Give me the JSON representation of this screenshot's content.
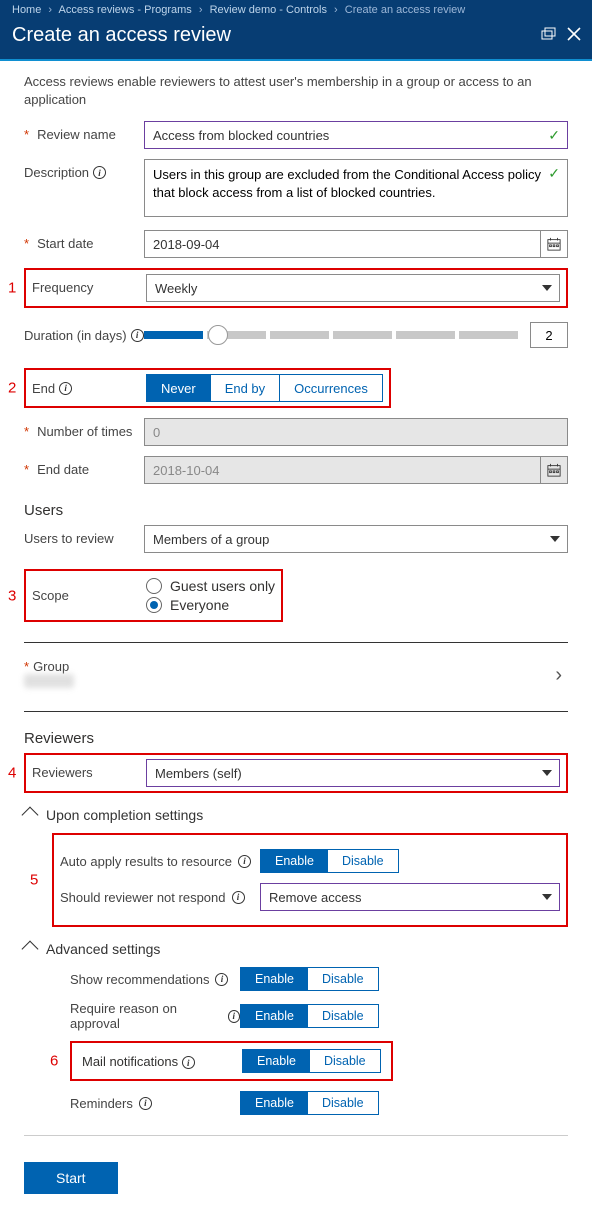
{
  "breadcrumbs": [
    "Home",
    "Access reviews - Programs",
    "Review demo - Controls",
    "Create an access review"
  ],
  "title": "Create an access review",
  "intro": "Access reviews enable reviewers to attest user's membership in a group or access to an application",
  "labels": {
    "reviewName": "Review name",
    "description": "Description",
    "startDate": "Start date",
    "frequency": "Frequency",
    "duration": "Duration (in days)",
    "end": "End",
    "numberOfTimes": "Number of times",
    "endDate": "End date",
    "usersHeader": "Users",
    "usersToReview": "Users to review",
    "scope": "Scope",
    "group": "Group",
    "reviewersHeader": "Reviewers",
    "reviewers": "Reviewers",
    "uponCompletion": "Upon completion settings",
    "advanced": "Advanced settings",
    "autoApply": "Auto apply results to resource",
    "notRespond": "Should reviewer not respond",
    "showRec": "Show recommendations",
    "requireReason": "Require reason on approval",
    "mailNotif": "Mail notifications",
    "reminders": "Reminders",
    "start": "Start"
  },
  "values": {
    "reviewName": "Access from blocked countries",
    "description": "Users in this group are excluded from the Conditional Access policy that block access from a list of blocked countries.",
    "startDate": "2018-09-04",
    "frequency": "Weekly",
    "durationValue": "2",
    "numberOfTimes": "0",
    "endDate": "2018-10-04",
    "usersToReview": "Members of a group",
    "scope": "Everyone",
    "reviewers": "Members (self)",
    "notRespond": "Remove access"
  },
  "options": {
    "end": [
      "Never",
      "End by",
      "Occurrences"
    ],
    "scope": [
      "Guest users only",
      "Everyone"
    ],
    "enableDisable": [
      "Enable",
      "Disable"
    ]
  },
  "annotations": {
    "1": "1",
    "2": "2",
    "3": "3",
    "4": "4",
    "5": "5",
    "6": "6"
  }
}
